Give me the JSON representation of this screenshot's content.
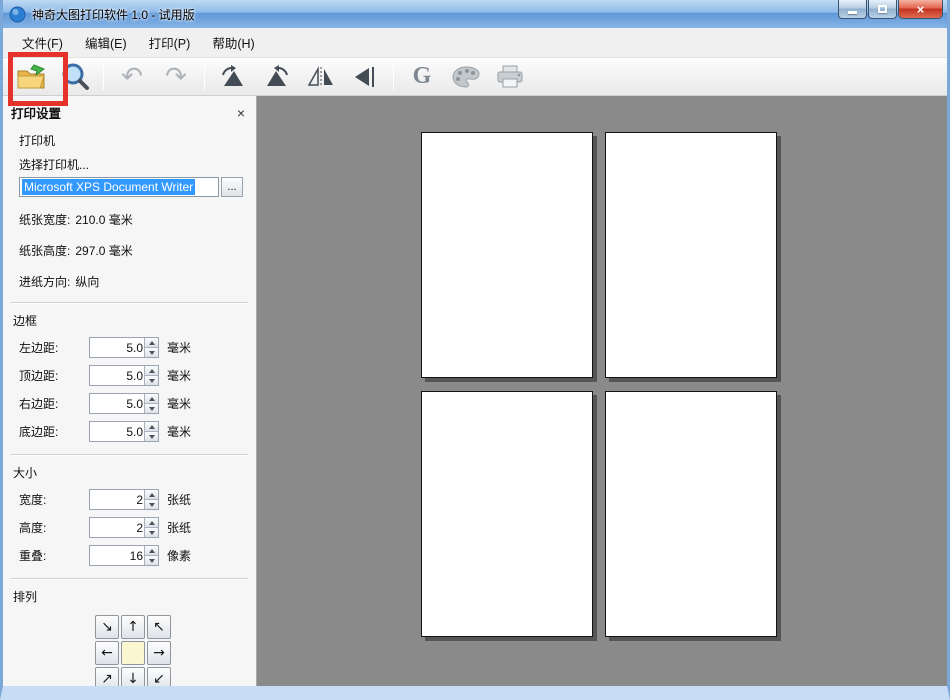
{
  "window": {
    "title": "神奇大图打印软件 1.0 - 试用版",
    "close_glyph": "×"
  },
  "menu": {
    "items": [
      {
        "label": "文件(F)"
      },
      {
        "label": "编辑(E)"
      },
      {
        "label": "打印(P)"
      },
      {
        "label": "帮助(H)"
      }
    ]
  },
  "toolbar": {
    "undo_glyph": "↶",
    "redo_glyph": "↷",
    "grayscale_glyph": "G"
  },
  "colors": {
    "annotation_highlight": "#e5322a",
    "selection_background": "#3399ff",
    "canvas_background": "#8a8a8a"
  },
  "panel": {
    "title": "打印设置",
    "close_glyph": "×",
    "printer": {
      "label": "打印机",
      "choose_label": "选择打印机...",
      "value": "Microsoft XPS Document Writer",
      "browse_label": "...",
      "info": [
        {
          "label": "纸张宽度:",
          "value": "210.0 毫米"
        },
        {
          "label": "纸张高度:",
          "value": "297.0 毫米"
        },
        {
          "label": "进纸方向:",
          "value": "纵向"
        }
      ]
    },
    "margins": {
      "title": "边框",
      "rows": [
        {
          "label": "左边距:",
          "value": "5.0",
          "unit": "毫米"
        },
        {
          "label": "顶边距:",
          "value": "5.0",
          "unit": "毫米"
        },
        {
          "label": "右边距:",
          "value": "5.0",
          "unit": "毫米"
        },
        {
          "label": "底边距:",
          "value": "5.0",
          "unit": "毫米"
        }
      ]
    },
    "size": {
      "title": "大小",
      "rows": [
        {
          "label": "宽度:",
          "value": "2",
          "unit": "张纸"
        },
        {
          "label": "高度:",
          "value": "2",
          "unit": "张纸"
        },
        {
          "label": "重叠:",
          "value": "16",
          "unit": "像素"
        }
      ]
    },
    "arrange": {
      "title": "排列",
      "arrows": [
        [
          "↘",
          "↑",
          "↖"
        ],
        [
          "←",
          "",
          "→"
        ],
        [
          "↗",
          "↓",
          "↙"
        ]
      ]
    }
  },
  "canvas": {
    "page_rows": 2,
    "page_cols": 2
  }
}
